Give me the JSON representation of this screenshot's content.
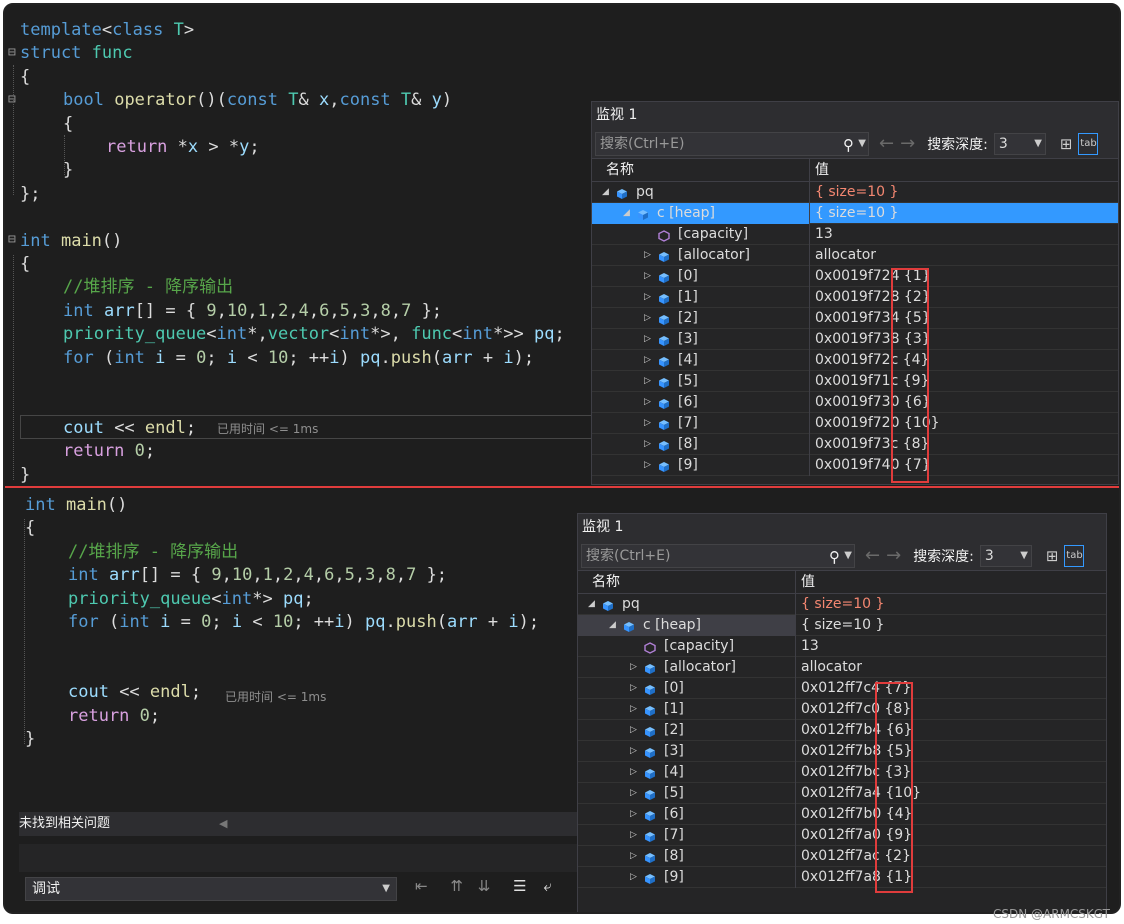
{
  "top": {
    "code_lines": [
      "template<class T>",
      "struct func",
      "{",
      "bool operator()(const T& x,const T& y)",
      "{",
      "return *x > *y;",
      "}",
      "};",
      "",
      "int main()",
      "{",
      "//堆排序 - 降序输出",
      "int arr[] = { 9,10,1,2,4,6,5,3,8,7 };",
      "priority_queue<int*,vector<int*>, func<int*>> pq;",
      "for (int i = 0; i < 10; ++i) pq.push(arr + i);",
      "",
      "",
      "cout << endl;",
      "return 0;",
      "}"
    ],
    "elapsed_hint": "已用时间 <= 1ms",
    "watch": {
      "title": "监视 1",
      "search_placeholder": "搜索(Ctrl+E)",
      "depth_label": "搜索深度:",
      "depth_value": "3",
      "col_name": "名称",
      "col_value": "值",
      "rows": [
        {
          "name": "pq",
          "value": "{ size=10 }",
          "level": 0,
          "expand": "open",
          "icon": "object",
          "red": true
        },
        {
          "name": "c [heap]",
          "value": "{ size=10 }",
          "level": 1,
          "expand": "open",
          "icon": "object",
          "selected": true
        },
        {
          "name": "[capacity]",
          "value": "13",
          "level": 2,
          "expand": "none",
          "icon": "property"
        },
        {
          "name": "[allocator]",
          "value": "allocator",
          "level": 2,
          "expand": "closed",
          "icon": "object"
        },
        {
          "name": "[0]",
          "value": "0x0019f724 {1}",
          "level": 2,
          "expand": "closed",
          "icon": "object"
        },
        {
          "name": "[1]",
          "value": "0x0019f728 {2}",
          "level": 2,
          "expand": "closed",
          "icon": "object"
        },
        {
          "name": "[2]",
          "value": "0x0019f734 {5}",
          "level": 2,
          "expand": "closed",
          "icon": "object"
        },
        {
          "name": "[3]",
          "value": "0x0019f738 {3}",
          "level": 2,
          "expand": "closed",
          "icon": "object"
        },
        {
          "name": "[4]",
          "value": "0x0019f72c {4}",
          "level": 2,
          "expand": "closed",
          "icon": "object"
        },
        {
          "name": "[5]",
          "value": "0x0019f71c {9}",
          "level": 2,
          "expand": "closed",
          "icon": "object"
        },
        {
          "name": "[6]",
          "value": "0x0019f730 {6}",
          "level": 2,
          "expand": "closed",
          "icon": "object"
        },
        {
          "name": "[7]",
          "value": "0x0019f720 {10}",
          "level": 2,
          "expand": "closed",
          "icon": "object"
        },
        {
          "name": "[8]",
          "value": "0x0019f73c {8}",
          "level": 2,
          "expand": "closed",
          "icon": "object"
        },
        {
          "name": "[9]",
          "value": "0x0019f740 {7}",
          "level": 2,
          "expand": "closed",
          "icon": "object"
        }
      ]
    }
  },
  "bottom": {
    "code_lines": [
      "int main()",
      "{",
      "//堆排序 - 降序输出",
      "int arr[] = { 9,10,1,2,4,6,5,3,8,7 };",
      "priority_queue<int*> pq;",
      "for (int i = 0; i < 10; ++i) pq.push(arr + i);",
      "",
      "",
      "cout << endl;",
      "return 0;",
      "}"
    ],
    "elapsed_hint": "已用时间 <= 1ms",
    "status_text": "未找到相关问题",
    "output_dropdown": "调试",
    "watch": {
      "title": "监视 1",
      "search_placeholder": "搜索(Ctrl+E)",
      "depth_label": "搜索深度:",
      "depth_value": "3",
      "col_name": "名称",
      "col_value": "值",
      "rows": [
        {
          "name": "pq",
          "value": "{ size=10 }",
          "level": 0,
          "expand": "open",
          "icon": "object",
          "red": true
        },
        {
          "name": "c [heap]",
          "value": "{ size=10 }",
          "level": 1,
          "expand": "open",
          "icon": "object",
          "highlight": true
        },
        {
          "name": "[capacity]",
          "value": "13",
          "level": 2,
          "expand": "none",
          "icon": "property"
        },
        {
          "name": "[allocator]",
          "value": "allocator",
          "level": 2,
          "expand": "closed",
          "icon": "object"
        },
        {
          "name": "[0]",
          "value": "0x012ff7c4 {7}",
          "level": 2,
          "expand": "closed",
          "icon": "object"
        },
        {
          "name": "[1]",
          "value": "0x012ff7c0 {8}",
          "level": 2,
          "expand": "closed",
          "icon": "object"
        },
        {
          "name": "[2]",
          "value": "0x012ff7b4 {6}",
          "level": 2,
          "expand": "closed",
          "icon": "object"
        },
        {
          "name": "[3]",
          "value": "0x012ff7b8 {5}",
          "level": 2,
          "expand": "closed",
          "icon": "object"
        },
        {
          "name": "[4]",
          "value": "0x012ff7bc {3}",
          "level": 2,
          "expand": "closed",
          "icon": "object"
        },
        {
          "name": "[5]",
          "value": "0x012ff7a4 {10}",
          "level": 2,
          "expand": "closed",
          "icon": "object"
        },
        {
          "name": "[6]",
          "value": "0x012ff7b0 {4}",
          "level": 2,
          "expand": "closed",
          "icon": "object"
        },
        {
          "name": "[7]",
          "value": "0x012ff7a0 {9}",
          "level": 2,
          "expand": "closed",
          "icon": "object"
        },
        {
          "name": "[8]",
          "value": "0x012ff7ac {2}",
          "level": 2,
          "expand": "closed",
          "icon": "object"
        },
        {
          "name": "[9]",
          "value": "0x012ff7a8 {1}",
          "level": 2,
          "expand": "closed",
          "icon": "object"
        }
      ]
    }
  },
  "watermark": "CSDN @ARMCSKGT",
  "colors": {
    "annotation_red": "#e03c3c",
    "selection_blue": "#3399ff",
    "editor_bg": "#1e1e1e"
  }
}
